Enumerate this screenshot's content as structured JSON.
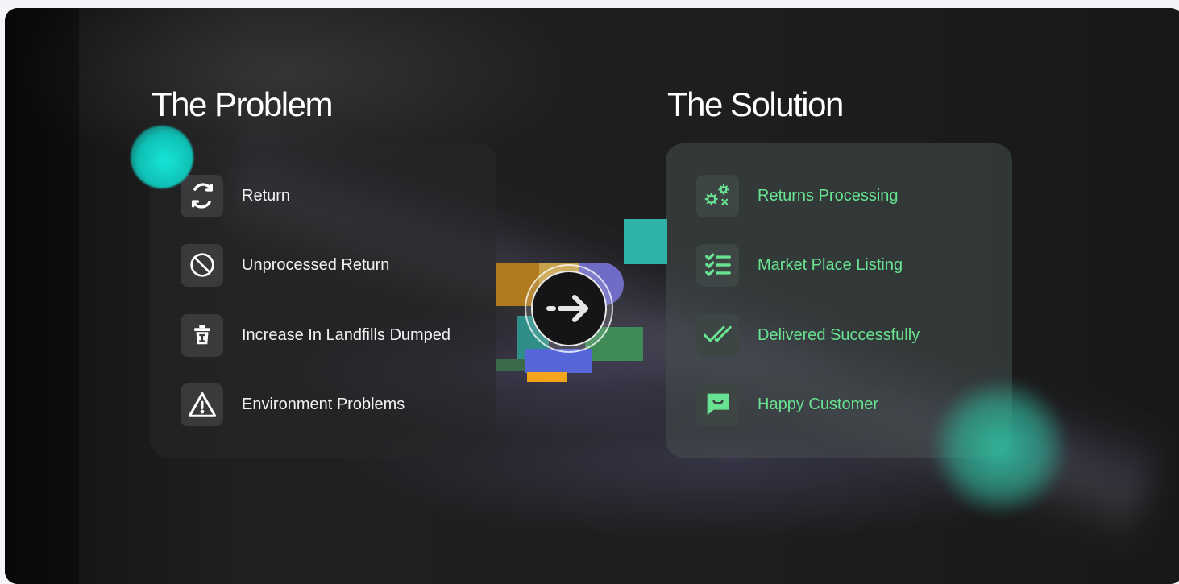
{
  "problem": {
    "title": "The Problem",
    "items": [
      {
        "label": "Return",
        "icon": "refresh-icon"
      },
      {
        "label": "Unprocessed Return",
        "icon": "prohibited-icon"
      },
      {
        "label": "Increase In Landfills Dumped",
        "icon": "trash-icon"
      },
      {
        "label": "Environment Problems",
        "icon": "warning-icon"
      }
    ]
  },
  "solution": {
    "title": "The  Solution",
    "items": [
      {
        "label": "Returns Processing",
        "icon": "gears-icon"
      },
      {
        "label": "Market Place Listing",
        "icon": "checklist-icon"
      },
      {
        "label": "Delivered Successfully",
        "icon": "double-check-icon"
      },
      {
        "label": "Happy Customer",
        "icon": "smile-chat-icon"
      }
    ]
  },
  "transition": {
    "icon": "arrow-right-icon"
  },
  "colors": {
    "background": "#1c1c1d",
    "solution_text": "#68e391",
    "problem_text": "#f2f2f2",
    "teal_accent": "#16e6d6"
  }
}
